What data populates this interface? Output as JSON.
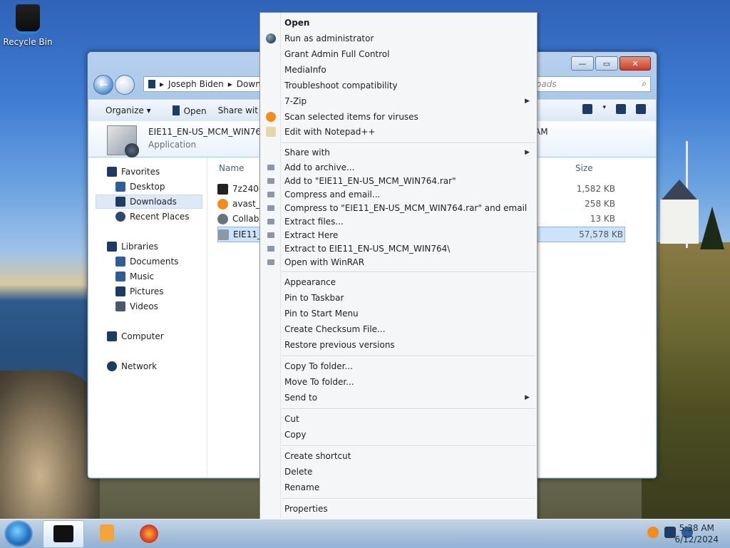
{
  "desktop": {
    "recycle_bin_label": "Recycle Bin"
  },
  "window": {
    "breadcrumb": [
      "Joseph Biden",
      "Down"
    ],
    "search_placeholder": "oads",
    "toolbar": {
      "organize": "Organize",
      "open": "Open",
      "share_with": "Share wit"
    },
    "details": {
      "name": "EIE11_EN-US_MCM_WIN764",
      "type": "Application",
      "right_fragment": "AM"
    },
    "nav": {
      "favorites": "Favorites",
      "desktop": "Desktop",
      "downloads": "Downloads",
      "recent_places": "Recent Places",
      "libraries": "Libraries",
      "documents": "Documents",
      "music": "Music",
      "pictures": "Pictures",
      "videos": "Videos",
      "computer": "Computer",
      "network": "Network"
    },
    "columns": {
      "name": "Name",
      "size": "Size"
    },
    "files": [
      {
        "name": "7z2406",
        "size": "1,582 KB"
      },
      {
        "name": "avast_f",
        "size": "258 KB"
      },
      {
        "name": "Collabi",
        "size": "13 KB"
      },
      {
        "name": "EIE11_E",
        "size": "57,578 KB"
      }
    ]
  },
  "context_menu": {
    "items": [
      {
        "label": "Open"
      },
      {
        "label": "Run as administrator"
      },
      {
        "label": "Grant Admin Full Control"
      },
      {
        "label": "MediaInfo"
      },
      {
        "label": "Troubleshoot compatibility"
      },
      {
        "label": "7-Zip"
      },
      {
        "label": "Scan selected items for viruses"
      },
      {
        "label": "Edit with Notepad++"
      },
      {
        "label": "Share with"
      },
      {
        "label": "Add to archive..."
      },
      {
        "label": "Add to \"EIE11_EN-US_MCM_WIN764.rar\""
      },
      {
        "label": "Compress and email..."
      },
      {
        "label": "Compress to \"EIE11_EN-US_MCM_WIN764.rar\" and email"
      },
      {
        "label": "Extract files..."
      },
      {
        "label": "Extract Here"
      },
      {
        "label": "Extract to EIE11_EN-US_MCM_WIN764\\"
      },
      {
        "label": "Open with WinRAR"
      },
      {
        "label": "Appearance"
      },
      {
        "label": "Pin to Taskbar"
      },
      {
        "label": "Pin to Start Menu"
      },
      {
        "label": "Create Checksum File..."
      },
      {
        "label": "Restore previous versions"
      },
      {
        "label": "Copy To folder..."
      },
      {
        "label": "Move To folder..."
      },
      {
        "label": "Send to"
      },
      {
        "label": "Cut"
      },
      {
        "label": "Copy"
      },
      {
        "label": "Create shortcut"
      },
      {
        "label": "Delete"
      },
      {
        "label": "Rename"
      },
      {
        "label": "Properties"
      }
    ]
  },
  "taskbar": {
    "time": "5:38 AM",
    "date": "6/12/2024"
  },
  "colors": {
    "accent": "#3b79c9",
    "selection": "#cde3fa",
    "avast_orange": "#f28c1a"
  }
}
